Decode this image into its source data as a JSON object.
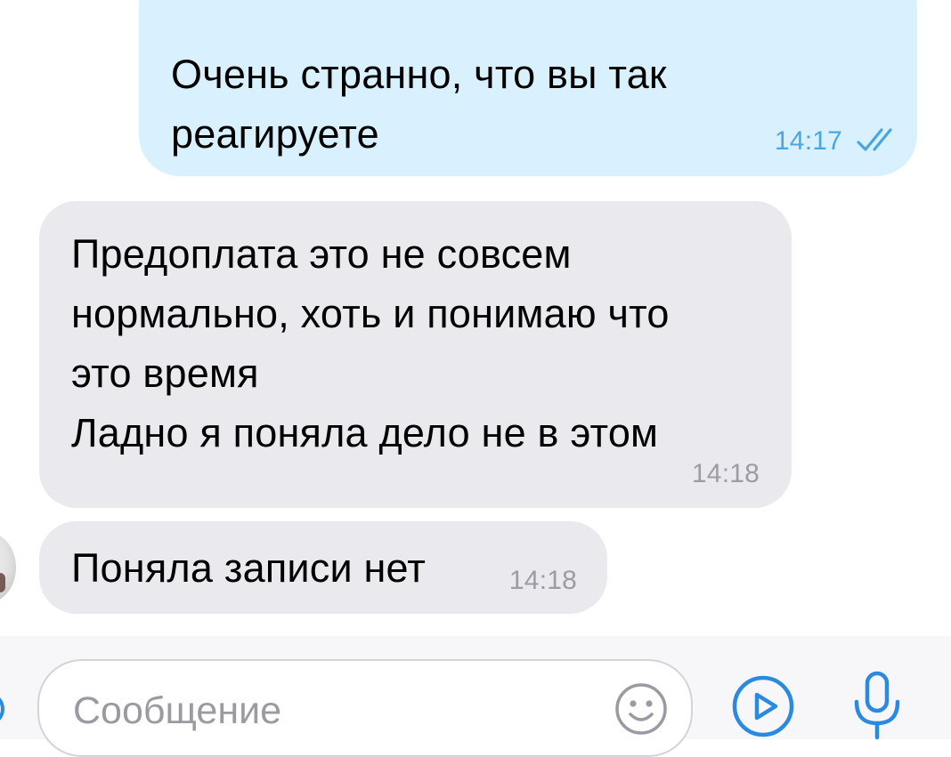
{
  "messages": [
    {
      "direction": "outgoing",
      "text": "Очень странно, что вы так\nреагируете",
      "time": "14:17",
      "status": "read"
    },
    {
      "direction": "incoming",
      "text": "Предоплата это не совсем\nнормально, хоть и понимаю что\nэто время\nЛадно я поняла дело не в этом",
      "time": "14:18"
    },
    {
      "direction": "incoming",
      "text": "Поняла записи нет",
      "time": "14:18"
    }
  ],
  "composer": {
    "placeholder": "Сообщение",
    "icons": {
      "emoji": "smiley-icon",
      "video": "video-message-icon",
      "mic": "microphone-icon",
      "attach": "attach-icon"
    }
  },
  "colors": {
    "outgoing_bubble": "#d9f1fe",
    "incoming_bubble": "#e9e9ee",
    "accent": "#2a8ae0",
    "read_time": "#4aa6e2",
    "muted_time": "#9c9ca3"
  }
}
